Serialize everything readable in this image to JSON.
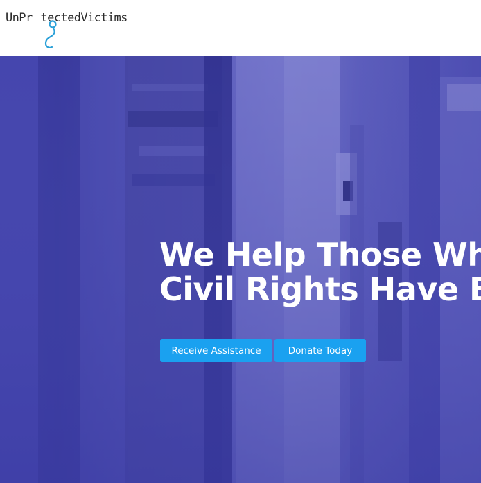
{
  "header": {
    "logo": {
      "before": "UnPr",
      "after": "tectedVictims",
      "alt": "UnProtectedVictims"
    }
  },
  "hero": {
    "headline_line1": "We Help Those Wh",
    "headline_line2": "Civil Rights Have B",
    "buttons": {
      "receive_assistance": "Receive Assistance",
      "donate_today": "Donate Today"
    }
  },
  "colors": {
    "accent": "#1aa1f0",
    "hero_tint": "#4b4baa",
    "logo_mark": "#2aa0d8"
  },
  "icons": {
    "logo_mark": "stethoscope-icon"
  }
}
